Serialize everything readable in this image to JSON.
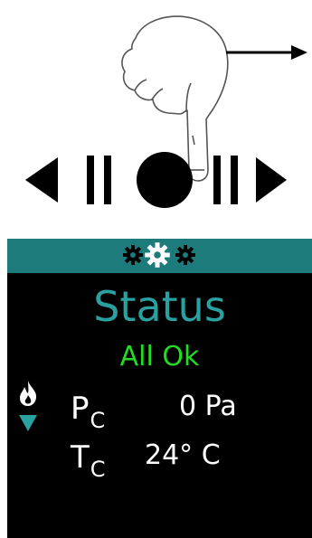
{
  "gesture": {
    "icons": [
      "pointing-hand-icon",
      "swipe-right-arrow-icon",
      "left-triangle-icon",
      "vertical-bars-icon",
      "center-dot-icon",
      "right-triangle-icon"
    ]
  },
  "screen": {
    "header_icons": [
      "gear-icon",
      "gear-icon",
      "gear-icon"
    ],
    "title": "Status",
    "status": "All Ok",
    "side_icons": [
      "flame-icon",
      "down-triangle-icon"
    ],
    "readings": [
      {
        "symbol": "P",
        "subscript": "C",
        "value": "0 Pa"
      },
      {
        "symbol": "T",
        "subscript": "C",
        "value": "24° C"
      }
    ],
    "colors": {
      "header": "#1e7b7b",
      "title": "#2aa0a0",
      "status_ok": "#22dd22",
      "background": "#000000",
      "text": "#ffffff"
    }
  }
}
